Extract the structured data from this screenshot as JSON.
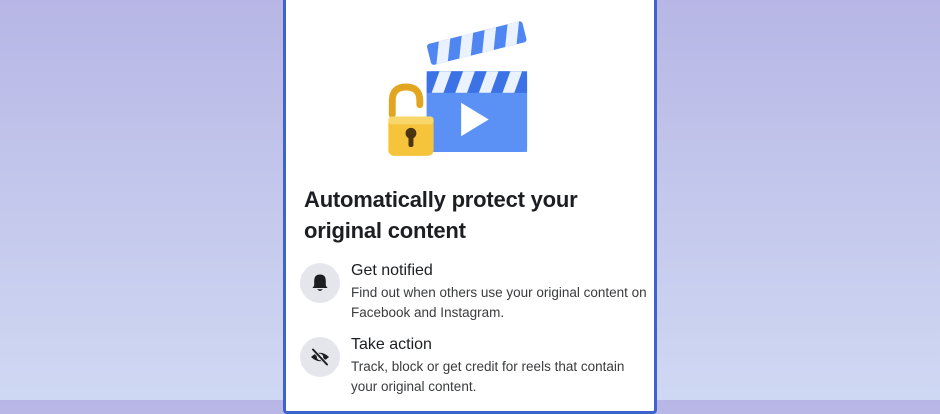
{
  "promo": {
    "title": "Automatically protect your original content",
    "features": [
      {
        "icon": "bell-icon",
        "title": "Get notified",
        "description": "Find out when others use your original content on Facebook and Instagram."
      },
      {
        "icon": "eye-slash-icon",
        "title": "Take action",
        "description": "Track, block or get credit for reels that contain your original content."
      }
    ]
  },
  "colors": {
    "background_top": "#b7b6e6",
    "background_bottom": "#cfd8f3",
    "frame_border": "#3e63cf",
    "clapper_blue": "#4f86f2",
    "lock_yellow": "#f5c43a",
    "icon_circle": "#e4e6eb",
    "text_primary": "#1c1e21"
  }
}
